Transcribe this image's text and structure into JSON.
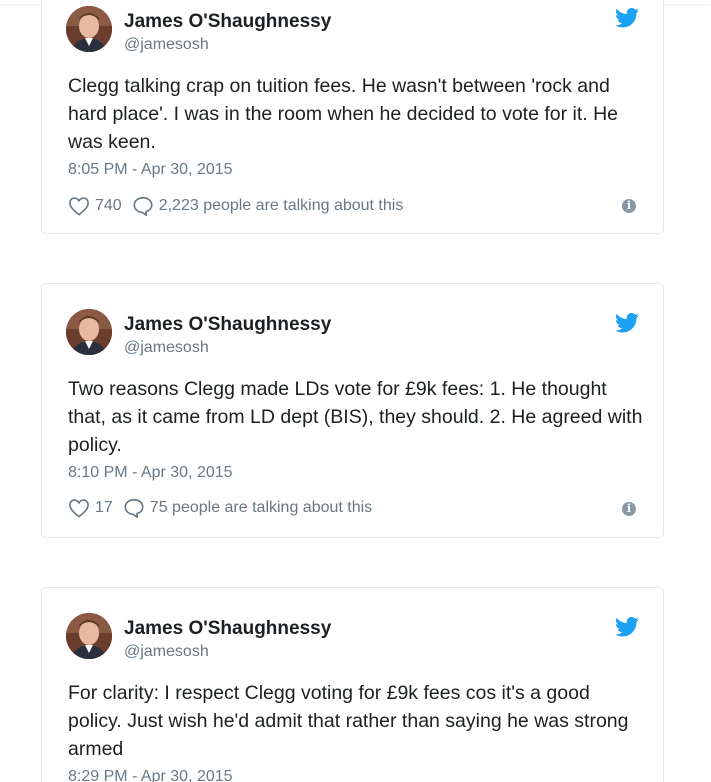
{
  "colors": {
    "twitter_blue": "#1da1f2",
    "text": "#1c2022",
    "muted": "#697882",
    "border": "#e1e8ed"
  },
  "tweets": [
    {
      "author_name": "James O'Shaughnessy",
      "author_handle": "@jamesosh",
      "text": "Clegg talking crap on tuition fees. He wasn't between 'rock and hard place'. I was in the room when he decided to vote for it. He was keen.",
      "timestamp": "8:05 PM - Apr 30, 2015",
      "likes": "740",
      "talking": "2,223 people are talking about this"
    },
    {
      "author_name": "James O'Shaughnessy",
      "author_handle": "@jamesosh",
      "text": "Two reasons Clegg made LDs vote for £9k fees: 1. He thought that, as it came from LD dept (BIS), they should. 2. He agreed with policy.",
      "timestamp": "8:10 PM - Apr 30, 2015",
      "likes": "17",
      "talking": "75 people are talking about this"
    },
    {
      "author_name": "James O'Shaughnessy",
      "author_handle": "@jamesosh",
      "text": "For clarity: I respect Clegg voting for £9k fees cos it's a good policy. Just wish he'd admit that rather than saying he was strong armed",
      "timestamp": "8:29 PM - Apr 30, 2015"
    }
  ],
  "icons": {
    "avatar": "avatar",
    "brand": "twitter-bird-icon",
    "like": "heart-icon",
    "reply": "speech-bubble-icon",
    "info": "info-icon"
  }
}
